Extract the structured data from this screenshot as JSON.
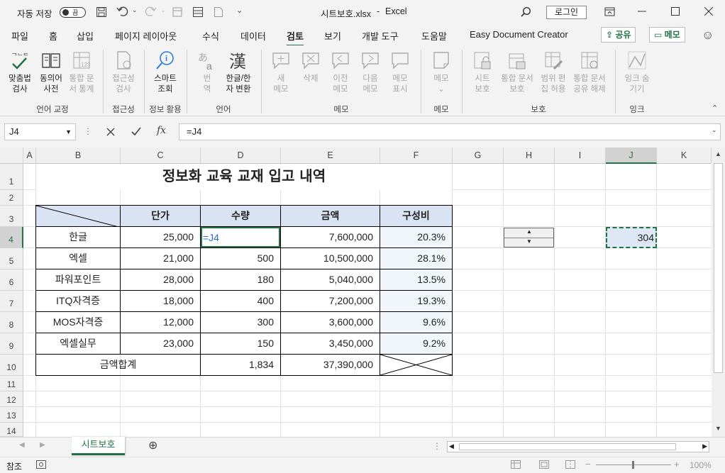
{
  "titlebar": {
    "autosave_label": "자동 저장",
    "autosave_state": "끔",
    "filename": "시트보호.xlsx",
    "separator": "-",
    "app_name": "Excel",
    "login_label": "로그인"
  },
  "tabs": [
    {
      "label": "파일"
    },
    {
      "label": "홈"
    },
    {
      "label": "삽입"
    },
    {
      "label": "페이지 레이아웃"
    },
    {
      "label": "수식"
    },
    {
      "label": "데이터"
    },
    {
      "label": "검토"
    },
    {
      "label": "보기"
    },
    {
      "label": "개발 도구"
    },
    {
      "label": "도움말"
    },
    {
      "label": "Easy Document Creator"
    }
  ],
  "tab_actions": {
    "share": "공유",
    "comments": "메모"
  },
  "ribbon": {
    "spelling": [
      "맞춤법",
      "검사"
    ],
    "thesaurus": [
      "동의어",
      "사전"
    ],
    "workbook_stats": [
      "통합 문",
      "서 통계"
    ],
    "check_accessibility": [
      "접근성",
      "검사"
    ],
    "smart_lookup": [
      "스마트",
      "조회"
    ],
    "translate": [
      "번",
      "역"
    ],
    "hangul_hanja": [
      "한글/한",
      "자 변환"
    ],
    "new_comment": [
      "새",
      "메모"
    ],
    "delete": [
      "삭제"
    ],
    "previous": [
      "이전",
      "메모"
    ],
    "next": [
      "다음",
      "메모"
    ],
    "show_comments": [
      "메모",
      "표시"
    ],
    "notes": [
      "메모"
    ],
    "protect_sheet": [
      "시트",
      "보호"
    ],
    "protect_workbook": [
      "통합 문서",
      "보호"
    ],
    "allow_edit_ranges": [
      "범위 편",
      "집 허용"
    ],
    "unshare_workbook": [
      "통합 문서",
      "공유 해제"
    ],
    "hide_ink": [
      "잉크 숨",
      "기기"
    ],
    "groups": [
      "언어 교정",
      "접근성",
      "정보 활용",
      "언어",
      "메모",
      "메모",
      "보호",
      "잉크"
    ]
  },
  "formula_bar": {
    "name_box": "J4",
    "formula": "=J4"
  },
  "columns": [
    "A",
    "B",
    "C",
    "D",
    "E",
    "F",
    "G",
    "H",
    "I",
    "J",
    "K"
  ],
  "rows": [
    "1",
    "2",
    "3",
    "4",
    "5",
    "6",
    "7",
    "8",
    "9",
    "10",
    "11",
    "12",
    "13",
    "14"
  ],
  "sheet": {
    "title": "정보화 교육 교재 입고 내역",
    "headers": [
      "단가",
      "수량",
      "금액",
      "구성비"
    ],
    "data": [
      {
        "name": "한글",
        "price": "25,000",
        "qty": "=J4",
        "amount": "7,600,000",
        "ratio": "20.3%"
      },
      {
        "name": "엑셀",
        "price": "21,000",
        "qty": "500",
        "amount": "10,500,000",
        "ratio": "28.1%"
      },
      {
        "name": "파워포인트",
        "price": "28,000",
        "qty": "180",
        "amount": "5,040,000",
        "ratio": "13.5%"
      },
      {
        "name": "ITQ자격증",
        "price": "18,000",
        "qty": "400",
        "amount": "7,200,000",
        "ratio": "19.3%"
      },
      {
        "name": "MOS자격증",
        "price": "12,000",
        "qty": "300",
        "amount": "3,600,000",
        "ratio": "9.6%"
      },
      {
        "name": "엑셀실무",
        "price": "23,000",
        "qty": "150",
        "amount": "3,450,000",
        "ratio": "9.2%"
      }
    ],
    "total": {
      "label": "금액합계",
      "qty": "1,834",
      "amount": "37,390,000"
    },
    "j4_value": "304"
  },
  "sheet_tabs": [
    {
      "label": "시트보호"
    }
  ],
  "status": {
    "mode": "참조",
    "zoom": "100%"
  }
}
